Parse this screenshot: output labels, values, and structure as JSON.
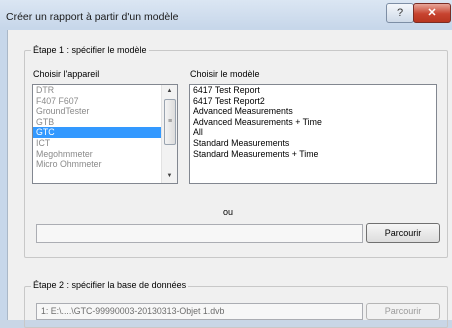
{
  "window": {
    "title": "Créer un rapport à partir d'un modèle",
    "help_glyph": "?",
    "close_glyph": "✕"
  },
  "step1": {
    "title": "Étape 1 : spécifier le modèle",
    "device_label": "Choisir l'appareil",
    "model_label": "Choisir le modèle",
    "devices": [
      "DTR",
      "F407 F607",
      "GroundTester",
      "GTB",
      "GTC",
      "ICT",
      "Megohmmeter",
      "Micro Ohmmeter"
    ],
    "selected_device": "GTC",
    "models": [
      "6417 Test Report",
      "6417 Test Report2",
      "Advanced Measurements",
      "Advanced Measurements + Time",
      "All",
      "Standard Measurements",
      "Standard Measurements + Time"
    ],
    "or_label": "ou",
    "file_path": "",
    "browse_label": "Parcourir"
  },
  "step2": {
    "title": "Étape 2 : spécifier la base de données",
    "db_path": "1: E:\\....\\GTC-99990003-20130313-Objet 1.dvb",
    "browse_label": "Parcourir"
  }
}
